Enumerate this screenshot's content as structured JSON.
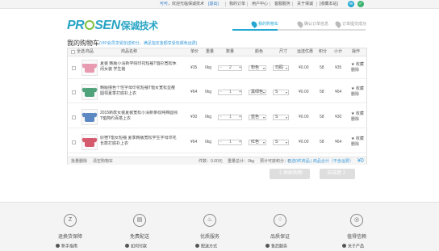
{
  "topbar": {
    "greeting_link": "可可",
    "greeting": "，欢迎光临保诚技术",
    "logout": "[退出]",
    "links": [
      "我的订单",
      "用户中心",
      "客服服务",
      "关于保诚",
      "[收藏本站]"
    ],
    "icons": [
      "weibo-icon",
      "weixin-icon"
    ]
  },
  "logo": {
    "text_pre": "PR",
    "text_post": "SEN",
    "cn": "保诚技术"
  },
  "steps": [
    "我的购物车",
    "确认订单信息",
    "订单提交成功"
  ],
  "cart": {
    "title": "我的购物车",
    "note": "(VIP会员享受加送积分，满足指定金额享受包邮免运费)",
    "headers": [
      "全选",
      "商品",
      "商品名称",
      "单价",
      "重量",
      "数量",
      "颜色",
      "尺寸",
      "运送优惠",
      "积分",
      "小计",
      "操作"
    ],
    "rows": [
      {
        "name": "夏装 韩版小清新学院印花短袖T恤衫宽松休闲女装 学生装",
        "price": "¥35",
        "weight": "0kg",
        "qty": "2",
        "color": "粉色",
        "size": "均码",
        "discount": "¥0.00",
        "points": "58",
        "subtotal": "¥35",
        "color_hex": "#e79ab0",
        "act_fav": "★ 收藏",
        "act_del": "删除"
      },
      {
        "name": "韩版撞色个性字母印花短袖T恤女宽松显瘦圆领夏季打底衫上衣",
        "price": "¥64",
        "weight": "0kg",
        "qty": "1",
        "color": "黑绿色",
        "size": "S",
        "discount": "¥0.00",
        "points": "58",
        "subtotal": "¥64",
        "color_hex": "#4fa27a",
        "act_fav": "★ 收藏",
        "act_del": "删除"
      },
      {
        "name": "2015新款女装夏装宽松小清新条纹纯棉圆领T恤简约百搭上衣",
        "price": "¥30",
        "weight": "0kg",
        "qty": "1",
        "color": "蓝色",
        "size": "S",
        "discount": "¥0.00",
        "points": "58",
        "subtotal": "¥30",
        "color_hex": "#5b87c2",
        "act_fav": "★ 收藏",
        "act_del": "删除"
      },
      {
        "name": "原宿T恤女短袖 夏季韩版宽松学生字母印花长款打底衫上衣",
        "price": "¥64",
        "weight": "0kg",
        "qty": "1",
        "color": "红色",
        "size": "S",
        "discount": "¥0.00",
        "points": "58",
        "subtotal": "¥64",
        "color_hex": "#d55a6e",
        "act_fav": "★ 收藏",
        "act_del": "删除"
      }
    ],
    "footer": {
      "delete_selected": "批量删除",
      "clear_cart": "清空购物车",
      "summary_pre": "件数：0.00元",
      "weight_sum": "重量总计：0kg",
      "points_sum": "预计可获积分：0",
      "summary_note": "已选0件商品 | 商品合计（不含运费）",
      "total": "¥0"
    }
  },
  "buttons": {
    "continue": "《 继续购物",
    "checkout": "去结算 》"
  },
  "features": [
    {
      "icon": "return-icon",
      "glyph": "Z",
      "title": "退换货保障",
      "sub": "新手指南"
    },
    {
      "icon": "truck-icon",
      "glyph": "▤",
      "title": "免费配送",
      "sub": "如何付款"
    },
    {
      "icon": "thumb-icon",
      "glyph": "♨",
      "title": "优质服务",
      "sub": "配送方式"
    },
    {
      "icon": "shield-icon",
      "glyph": "♢",
      "title": "品质保证",
      "sub": "售后服务"
    },
    {
      "icon": "medal-icon",
      "glyph": "◎",
      "title": "值得信赖",
      "sub": "关于产品"
    }
  ]
}
